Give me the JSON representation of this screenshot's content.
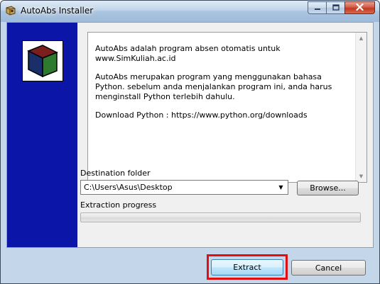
{
  "window": {
    "title": "AutoAbs Installer",
    "icon": "installer-app-icon",
    "controls": [
      "minimize-icon",
      "maximize-icon",
      "close-icon"
    ]
  },
  "readme": {
    "paragraphs": [
      "AutoAbs adalah program absen otomatis untuk\nwww.SimKuliah.ac.id",
      "AutoAbs merupakan program yang menggunakan bahasa\nPython. sebelum anda menjalankan program ini, anda harus\nmenginstall Python terlebih dahulu.",
      "Download Python : https://www.python.org/downloads"
    ]
  },
  "destination": {
    "label": "Destination folder",
    "value": "C:\\Users\\Asus\\Desktop",
    "browse_label": "Browse..."
  },
  "extraction": {
    "label": "Extraction progress",
    "progress": 0
  },
  "buttons": {
    "extract_label": "Extract",
    "cancel_label": "Cancel"
  },
  "colors": {
    "side_panel": "#0b15a8",
    "highlight": "#e01010"
  }
}
